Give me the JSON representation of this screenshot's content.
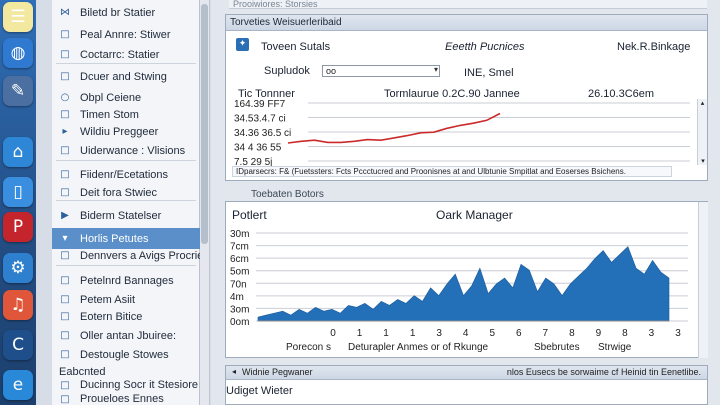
{
  "dock": {
    "icons": [
      {
        "name": "notes-app-icon",
        "glyph": "☰",
        "color": "#f3e8a0"
      },
      {
        "name": "globe-icon",
        "glyph": "◍",
        "color": "#2f7ad0"
      },
      {
        "name": "tools-icon",
        "glyph": "✎",
        "color": "#4b6fa0"
      },
      {
        "name": "shop-bag-icon",
        "glyph": "⌂",
        "color": "#2e86d6"
      },
      {
        "name": "phone-icon",
        "glyph": "▯",
        "color": "#3a8ee0"
      },
      {
        "name": "pinterest-icon",
        "glyph": "P",
        "color": "#c4242b"
      },
      {
        "name": "settings-gear-icon",
        "glyph": "⚙",
        "color": "#2f7fcf"
      },
      {
        "name": "music-app-icon",
        "glyph": "♫",
        "color": "#e0563a"
      },
      {
        "name": "circle-logo-icon",
        "glyph": "C",
        "color": "#1f4f8a"
      },
      {
        "name": "browser-e-icon",
        "glyph": "e",
        "color": "#2a88d8"
      }
    ]
  },
  "sidebar": {
    "items": [
      {
        "label": "Biletd br Statier",
        "icon": "bow-tie-icon",
        "glyph": "⋈",
        "selected": false
      },
      {
        "label": "Peal Annre: Stiwer",
        "icon": "square-outline-icon",
        "glyph": "□",
        "selected": false
      },
      {
        "label": "Coctarrc: Statier",
        "icon": "square-outline-icon",
        "glyph": "□",
        "selected": false
      },
      {
        "label": "Dcuer and Stwing",
        "icon": "square-outline-icon",
        "glyph": "□",
        "selected": false
      },
      {
        "label": "Obpl Ceiene",
        "icon": "circle-icon",
        "glyph": "○",
        "selected": false
      },
      {
        "label": "Timen Stom",
        "icon": "square-outline-icon",
        "glyph": "□",
        "selected": false
      },
      {
        "label": "Wildiu Preggeer",
        "icon": "arrow-right-icon",
        "glyph": "▸",
        "selected": false
      },
      {
        "label": "Uiderwance : Vlisions",
        "icon": "square-outline-icon",
        "glyph": "□",
        "selected": false
      },
      {
        "label": "Fiidenr/Ecetations",
        "icon": "square-outline-icon",
        "glyph": "□",
        "selected": false
      },
      {
        "label": "Deit fora Stwiec",
        "icon": "square-outline-icon",
        "glyph": "□",
        "selected": false
      },
      {
        "label": "Biderm Statelser",
        "icon": "play-arrow-icon",
        "glyph": "▶",
        "selected": false
      },
      {
        "label": "Horlis Petutes",
        "icon": "chevron-down-icon",
        "glyph": "▾",
        "selected": true
      },
      {
        "label": "Dennvers a Avigs Procries",
        "icon": "square-outline-icon",
        "glyph": "□",
        "selected": false
      },
      {
        "label": "Petelnrd Bannages",
        "icon": "square-outline-icon",
        "glyph": "□",
        "selected": false
      },
      {
        "label": "Petem Asiit",
        "icon": "square-outline-icon",
        "glyph": "□",
        "selected": false
      },
      {
        "label": "Eotern Bitice",
        "icon": "square-outline-icon",
        "glyph": "□",
        "selected": false
      },
      {
        "label": "Oller antan Jbuiree:",
        "icon": "square-outline-icon",
        "glyph": "□",
        "selected": false
      },
      {
        "label": "Destougle Stowes",
        "icon": "square-outline-icon",
        "glyph": "□",
        "selected": false
      }
    ],
    "footer_label": "Eabcnted",
    "footer_items": [
      {
        "label": "Ducinng Socr it Stesiore",
        "glyph": "□"
      },
      {
        "label": "Proueloes Ennes",
        "glyph": "□"
      }
    ]
  },
  "main": {
    "top_strip": "Prooiwiores: Storsies",
    "panel1": {
      "title": "Torveties Weisuerleribaid",
      "header_icon": "bookmark-icon",
      "header_left": "Toveen Sutals",
      "header_mid": "Eeetth Pucnices",
      "header_right": "Nek.R.Binkage",
      "select_label": "Supludok",
      "select_value": "oo",
      "select_suffix": "INE, Smel",
      "col_left": "Tic Tonnner",
      "col_mid": "Tormlaurue  0.2C.90 Jannee",
      "col_right": "26.10.3C6em",
      "y_ticks": [
        "164.39 FF7",
        "34.53.4.7 ci",
        "34.36 36.5 ci",
        "34 4 36 55",
        "7.5 29 5j"
      ],
      "footnote": "IDparsecrs: F& (Fuetssters: Fcts Pccctucred and Proonisnes at and Ulbtunie Smpitlat and Eoserses Bsichens.",
      "line_color": "#cc2a2a",
      "line_values": [
        0.0,
        0.3,
        0.5,
        0.1,
        0.1,
        0.3,
        0.6,
        0.5,
        0.9,
        1.3,
        1.8,
        1.9,
        2.6,
        3.1,
        3.5,
        4.0,
        5.2
      ]
    },
    "panel2": {
      "title": "Toebaten Botors",
      "head_left": "Potlert",
      "head_mid": "Oark Manager",
      "y_ticks": [
        "30m",
        "7cm",
        "6cm",
        "5om",
        "70n",
        "4m",
        "3om",
        "0om"
      ],
      "x_ticks": [
        "0",
        "1",
        "1",
        "1",
        "3",
        "4",
        "5",
        "6",
        "7",
        "8",
        "9",
        "8",
        "3",
        "3"
      ],
      "x_labels": [
        "Porecon s",
        "Deturapler Anmes  or of Rkunge",
        "Sbebrutes",
        "Strwige"
      ],
      "area_color": "#2370b8",
      "area_values": [
        2,
        3,
        4,
        5,
        3,
        6,
        4,
        7,
        5,
        6,
        4,
        8,
        7,
        9,
        6,
        10,
        8,
        11,
        9,
        13,
        10,
        17,
        13,
        19,
        24,
        13,
        18,
        27,
        14,
        19,
        22,
        17,
        29,
        26,
        15,
        22,
        19,
        13,
        19,
        23,
        27,
        32,
        36,
        30,
        34,
        38,
        27,
        24,
        31,
        25,
        22
      ]
    },
    "panel3": {
      "title": "Widnie Pegwaner",
      "right_text": "nlos Eusecs be sorwaime cf  Heinid tin Eenetlibe.",
      "body_text": "Udiget Wieter"
    }
  }
}
